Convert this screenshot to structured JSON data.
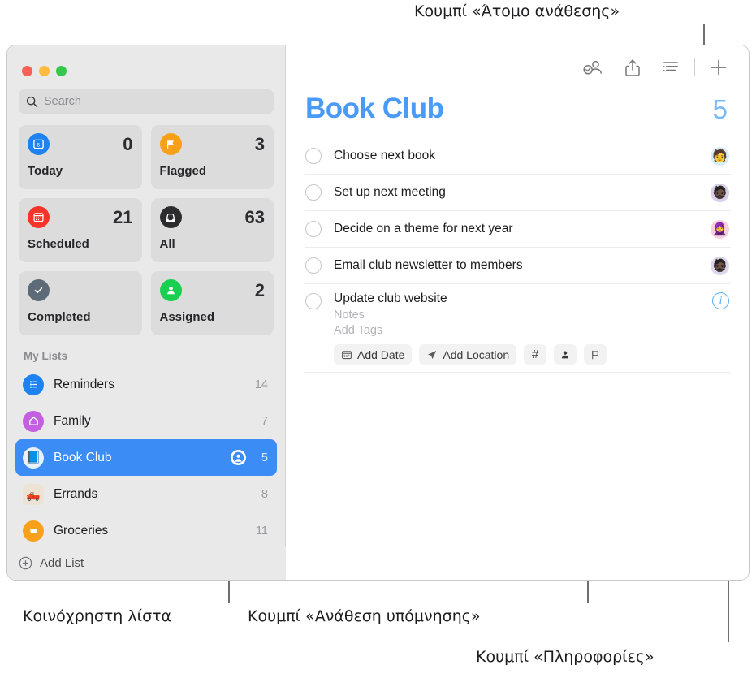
{
  "annotations": [
    {
      "text": "Κουμπί «Άτομο ανάθεσης»",
      "name": "annotation-assignee-button"
    },
    {
      "text": "Κοινόχρηστη λίστα",
      "name": "annotation-shared-list"
    },
    {
      "text": "Κουμπί «Ανάθεση υπόμνησης»",
      "name": "annotation-assign-reminder-button"
    },
    {
      "text": "Κουμπί «Πληροφορίες»",
      "name": "annotation-info-button"
    }
  ],
  "sidebar": {
    "search": {
      "placeholder": "Search",
      "icon": "search-icon"
    },
    "tiles": [
      {
        "label": "Today",
        "count": "0",
        "icon": "calendar-day-icon",
        "color": "#1e82f0"
      },
      {
        "label": "Flagged",
        "count": "3",
        "icon": "flag-icon",
        "color": "#f9a01b"
      },
      {
        "label": "Scheduled",
        "count": "21",
        "icon": "calendar-icon",
        "color": "#f5342a"
      },
      {
        "label": "All",
        "count": "63",
        "icon": "inbox-icon",
        "color": "#2c2c2e"
      },
      {
        "label": "Completed",
        "count": "",
        "icon": "checkmark-icon",
        "color": "#5c6b77"
      },
      {
        "label": "Assigned",
        "count": "2",
        "icon": "person-icon",
        "color": "#19cf50"
      }
    ],
    "my_lists_header": "My Lists",
    "lists": [
      {
        "name": "Reminders",
        "count": "14",
        "icon": "list-bullet-icon",
        "color": "#1e82f0",
        "shared": false,
        "selected": false
      },
      {
        "name": "Family",
        "count": "7",
        "icon": "house-icon",
        "color": "#c35fe0",
        "shared": false,
        "selected": false
      },
      {
        "name": "Book Club",
        "count": "5",
        "icon": "book-icon",
        "color": "#e8f1fb",
        "shared": true,
        "selected": true
      },
      {
        "name": "Errands",
        "count": "8",
        "icon": "truck-icon",
        "color": "#ece3d4",
        "shared": false,
        "selected": false
      },
      {
        "name": "Groceries",
        "count": "11",
        "icon": "cart-icon",
        "color": "#f9a01b",
        "shared": false,
        "selected": false
      }
    ],
    "add_list": {
      "label": "Add List",
      "icon": "plus-circle-icon"
    }
  },
  "main": {
    "toolbar": [
      {
        "name": "assignee-button",
        "icon": "person-badge-check-icon"
      },
      {
        "name": "share-button",
        "icon": "share-icon"
      },
      {
        "name": "view-options-button",
        "icon": "list-lines-icon"
      },
      {
        "name": "add-reminder-button",
        "icon": "plus-icon"
      }
    ],
    "title": "Book Club",
    "total": "5",
    "reminders": [
      {
        "text": "Choose next book",
        "avatar": "🧑",
        "avatar_bg": "#d6edf7",
        "expanded": false
      },
      {
        "text": "Set up next meeting",
        "avatar": "🧔🏿",
        "avatar_bg": "#d9cfe8",
        "expanded": false
      },
      {
        "text": "Decide on a theme for next year",
        "avatar": "🧕",
        "avatar_bg": "#f6cede",
        "expanded": false
      },
      {
        "text": "Email club newsletter to members",
        "avatar": "🧔🏿",
        "avatar_bg": "#ddd6ec",
        "expanded": false
      }
    ],
    "expanded_reminder": {
      "title": "Update club website",
      "notes_placeholder": "Notes",
      "tags_placeholder": "Add Tags",
      "chips": [
        {
          "label": "Add Date",
          "icon": "calendar-icon",
          "name": "add-date-button"
        },
        {
          "label": "Add Location",
          "icon": "location-arrow-icon",
          "name": "add-location-button"
        },
        {
          "label": "#",
          "icon": "hash-icon",
          "name": "add-tag-button"
        },
        {
          "label": "",
          "icon": "person-icon",
          "name": "assign-reminder-button"
        },
        {
          "label": "",
          "icon": "flag-icon",
          "name": "flag-button"
        }
      ],
      "info_label": "i"
    }
  },
  "colors": {
    "accent": "#3b8cf5",
    "title": "#4a9bf7",
    "sidebar_bg": "#e9e9e9"
  }
}
